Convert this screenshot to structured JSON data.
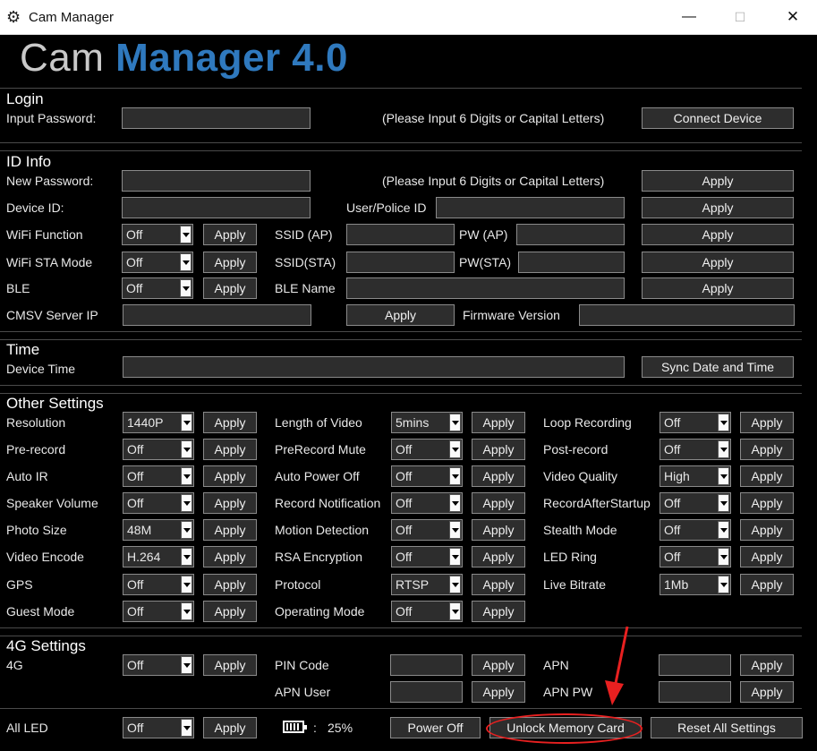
{
  "window": {
    "title": "Cam Manager",
    "minimize": "—",
    "maximize": "☐",
    "close": "✕"
  },
  "banner": {
    "part1": "Cam ",
    "part2": "Manager 4.0"
  },
  "login": {
    "title": "Login",
    "password_label": "Input Password:",
    "hint": "(Please Input 6 Digits or Capital Letters)",
    "connect_button": "Connect Device"
  },
  "id_info": {
    "title": "ID Info",
    "new_password_label": "New Password:",
    "hint": "(Please Input 6 Digits or Capital Letters)",
    "device_id_label": "Device ID:",
    "user_police_id_label": "User/Police ID",
    "wifi_function_label": "WiFi Function",
    "wifi_function_value": "Off",
    "ssid_ap_label": "SSID (AP)",
    "pw_ap_label": "PW (AP)",
    "wifi_sta_label": "WiFi STA Mode",
    "wifi_sta_value": "Off",
    "ssid_sta_label": "SSID(STA)",
    "pw_sta_label": "PW(STA)",
    "ble_label": "BLE",
    "ble_value": "Off",
    "ble_name_label": "BLE Name",
    "cmsv_label": "CMSV Server IP",
    "firmware_label": "Firmware Version",
    "apply": "Apply"
  },
  "time": {
    "title": "Time",
    "device_time_label": "Device Time",
    "sync_button": "Sync Date and Time"
  },
  "other": {
    "title": "Other Settings",
    "apply": "Apply",
    "col1": [
      {
        "label": "Resolution",
        "value": "1440P"
      },
      {
        "label": "Pre-record",
        "value": "Off"
      },
      {
        "label": "Auto IR",
        "value": "Off"
      },
      {
        "label": "Speaker Volume",
        "value": "Off"
      },
      {
        "label": "Photo Size",
        "value": "48M"
      },
      {
        "label": "Video Encode",
        "value": "H.264"
      },
      {
        "label": "GPS",
        "value": "Off"
      },
      {
        "label": "Guest Mode",
        "value": "Off"
      }
    ],
    "col2": [
      {
        "label": "Length of Video",
        "value": "5mins"
      },
      {
        "label": "PreRecord Mute",
        "value": "Off"
      },
      {
        "label": "Auto Power Off",
        "value": "Off"
      },
      {
        "label": "Record Notification",
        "value": "Off"
      },
      {
        "label": "Motion Detection",
        "value": "Off"
      },
      {
        "label": "RSA Encryption",
        "value": "Off"
      },
      {
        "label": "Protocol",
        "value": "RTSP"
      },
      {
        "label": "Operating Mode",
        "value": "Off"
      }
    ],
    "col3": [
      {
        "label": "Loop Recording",
        "value": "Off"
      },
      {
        "label": "Post-record",
        "value": "Off"
      },
      {
        "label": "Video Quality",
        "value": "High"
      },
      {
        "label": "RecordAfterStartup",
        "value": "Off"
      },
      {
        "label": "Stealth Mode",
        "value": "Off"
      },
      {
        "label": "LED Ring",
        "value": "Off"
      },
      {
        "label": "Live Bitrate",
        "value": "1Mb"
      }
    ]
  },
  "g4": {
    "title": "4G Settings",
    "g4_label": "4G",
    "g4_value": "Off",
    "pin_label": "PIN Code",
    "apn_label": "APN",
    "apn_user_label": "APN User",
    "apn_pw_label": "APN PW",
    "apply": "Apply"
  },
  "bottom": {
    "all_led_label": "All LED",
    "all_led_value": "Off",
    "apply": "Apply",
    "battery_sep": ":",
    "battery_level": "25%",
    "power_off": "Power Off",
    "unlock": "Unlock Memory Card",
    "reset": "Reset All Settings"
  },
  "colors": {
    "accent": "#2f79be",
    "annotation": "#e82020"
  }
}
